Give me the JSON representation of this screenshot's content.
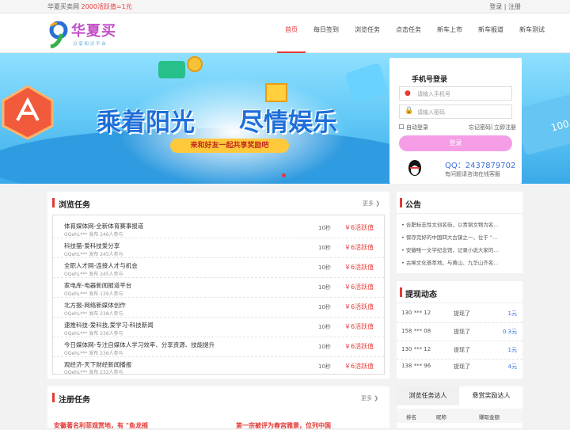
{
  "topbar": {
    "site": "华夏买卖网",
    "promo": "2000活跃值=1元",
    "login": "登录",
    "sep": "|",
    "register": "注册"
  },
  "logo": {
    "name": "华夏买",
    "slogan": "分 享 知 识 平 台"
  },
  "nav": [
    "首页",
    "每日签到",
    "浏览任务",
    "点击任务",
    "新车上市",
    "新车报道",
    "新车测试"
  ],
  "banner": {
    "headline1": "乘着阳光",
    "headline2": "尽情娱乐",
    "sub": "来和好友一起共享奖励吧"
  },
  "login": {
    "title": "手机号登录",
    "phone_placeholder": "请输入手机号",
    "password_placeholder": "请输入密码",
    "auto_login": "自动登录",
    "forgot": "忘记密码",
    "register": "立即注册",
    "button": "登录",
    "qq": "QQ：2437879702",
    "qq_note": "有问题请咨询在线客服"
  },
  "browse": {
    "title": "浏览任务",
    "more": "更多",
    "tasks": [
      {
        "name": "体育媒体网-全新体育赛事报道",
        "meta": "OQehL*** 发布  246人参与",
        "sec": "10秒",
        "reward": "￥6活跃值"
      },
      {
        "name": "科技猫-爱科技爱分享",
        "meta": "OQehL*** 发布  245人参与",
        "sec": "10秒",
        "reward": "￥6活跃值"
      },
      {
        "name": "全职人才网-连接人才与机会",
        "meta": "OQehL*** 发布  245人参与",
        "sec": "10秒",
        "reward": "￥6活跃值"
      },
      {
        "name": "家电库-电器新闻报道平台",
        "meta": "OQehL*** 发布  139人参与",
        "sec": "10秒",
        "reward": "￥6活跃值"
      },
      {
        "name": "北方报-网络新媒体创作",
        "meta": "OQehL*** 发布  238人参与",
        "sec": "10秒",
        "reward": "￥6活跃值"
      },
      {
        "name": "速推科技-爱科技,爱学习-科技新闻",
        "meta": "OQehL*** 发布  236人参与",
        "sec": "10秒",
        "reward": "￥6活跃值"
      },
      {
        "name": "今日媒体网-专注自媒体人学习效率、分享资源、技能提升",
        "meta": "OQehL*** 发布  236人参与",
        "sec": "10秒",
        "reward": "￥6活跃值"
      },
      {
        "name": "观经济-天下财经新闻播报",
        "meta": "OQehL*** 发布  232人参与",
        "sec": "10秒",
        "reward": "￥6活跃值"
      }
    ]
  },
  "notice": {
    "title": "公告",
    "items": [
      "合肥标志性文创名街，以青铜文物为名…",
      "保存完好的中国四大古镇之一，位于 \"…",
      "安徽唯一文学纪念馆，记录小说大家的…",
      "古稀文化荟萃地，与黄山、九华山齐名…"
    ]
  },
  "withdraw": {
    "title": "提现动态",
    "rows": [
      {
        "user": "130 *** 12",
        "action": "提现了",
        "amount": "1元"
      },
      {
        "user": "158 *** 08",
        "action": "提现了",
        "amount": "0.3元"
      },
      {
        "user": "130 *** 12",
        "action": "提现了",
        "amount": "1元"
      },
      {
        "user": "138 *** 96",
        "action": "提现了",
        "amount": "4元"
      }
    ]
  },
  "register_tasks": {
    "title": "注册任务",
    "more": "更多",
    "items": [
      "安徽著名利菲观赏地，有 \"鱼龙摇",
      "第一宗被评为春宫雅景，位列中国"
    ]
  },
  "ranking": {
    "tabs": [
      "浏览任务达人",
      "悬赏奖励达人"
    ],
    "cols": [
      "排名",
      "昵称",
      "赚取金额"
    ]
  },
  "colors": {
    "accent": "#e53935",
    "login_btn": "#f59de6",
    "link": "#3a6fd8"
  }
}
